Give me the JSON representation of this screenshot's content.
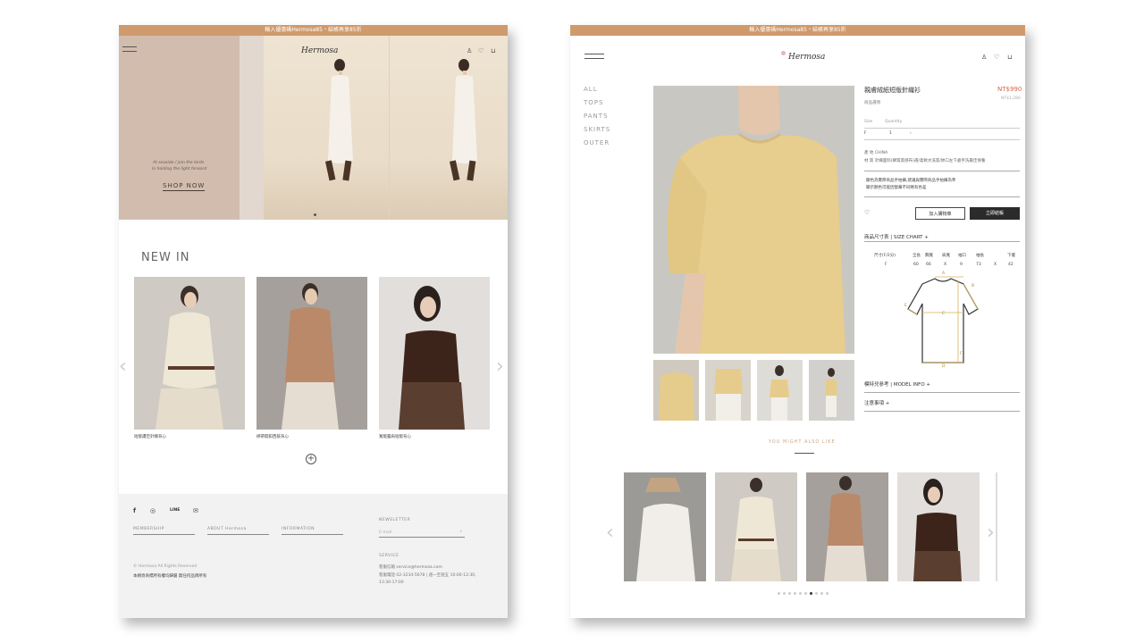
{
  "left_page": {
    "announcement": "輸入優惠碼Hermosa85・結帳再享85折",
    "logo": "Hermosa",
    "hero": {
      "tagline_1": "At seaside / join the birds",
      "tagline_2": "In holding the light forward",
      "cta": "SHOP NOW"
    },
    "section_title": "NEW IN",
    "products": [
      {
        "name": "短版鏤空針織背心"
      },
      {
        "name": "綁帶開釦西裝背心"
      },
      {
        "name": "寬版露肩短版背心"
      }
    ],
    "footer": {
      "social": {
        "line": "LINE"
      },
      "menus": [
        "MEMBERSHIP",
        "ABOUT Hermosa",
        "INFORMATION"
      ],
      "newsletter_title": "NEWSLETTER",
      "email_placeholder": "E-mail",
      "copyright": "© Hermosa All Rights Reserved",
      "copyright_2": "本網頁商標所有權均歸屬 無任何品牌所有",
      "service_title": "SERVICE",
      "service_email": "客服信箱 service@hermosa.com",
      "service_phone": "客服電話 02-3234-5678 | 週一至週五 10:00-12:30, 13:30-17:00"
    }
  },
  "right_page": {
    "announcement": "輸入優惠碼Hermosa85・結帳再享85折",
    "logo": "Hermosa",
    "nav": [
      "ALL",
      "TOPS",
      "PANTS",
      "SKIRTS",
      "OUTER"
    ],
    "product": {
      "title": "親膚絨紙短版針織衫",
      "subtitle": "商品選項",
      "price": "NT$990",
      "price_sub": "NT$1,280",
      "size_label": "Size",
      "qty_label": "Quantity",
      "size_value": "F",
      "qty_value": "1",
      "info_line_1": "產 地 CHINA",
      "info_line_2": "材 質 針織面料(綿質質感布)選/柔軟水洗質/帥口左下處手洗最佳保養",
      "note_1": "顯色為實際商品手拍攝,建議與實際商品手拍攝為準",
      "note_2": "顯示顏色可能因螢幕不同略有色差",
      "add_to_cart": "加入購物車",
      "buy_now": "立即結帳",
      "size_chart_label": "商品尺寸表 | SIZE CHART +",
      "size_table": {
        "headers": [
          "尺寸(F/2分)",
          "全長",
          "胸寬",
          "肩寬",
          "袖長",
          "袖口",
          "下擺"
        ],
        "row": [
          "F",
          "60",
          "66",
          "X",
          "9",
          "73",
          "X",
          "42"
        ]
      },
      "model_info": "模特兒參考 | MODEL INFO +",
      "notice": "注意事項 +"
    },
    "also_like": "YOU MIGHT ALSO LIKE",
    "colors": {
      "accent": "#cf9a6c",
      "hero_bg": "#d2bcae",
      "dark_button": "#2b2b2b",
      "footer_bg": "#f1f2f1"
    }
  }
}
